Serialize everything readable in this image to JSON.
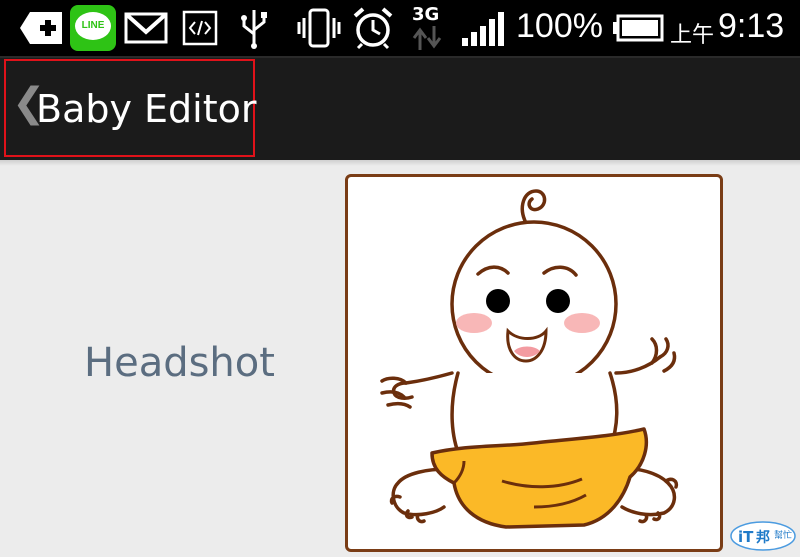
{
  "status_bar": {
    "icons": [
      "add-icon",
      "line-app-icon",
      "gmail-icon",
      "developer-icon",
      "usb-icon",
      "vibrate-icon",
      "alarm-icon",
      "network-3g-icon",
      "signal-icon",
      "battery-icon"
    ],
    "line_label": "LINE",
    "network_label": "3G",
    "battery_percent": "100%",
    "time_prefix": "上午",
    "time": "9:13"
  },
  "action_bar": {
    "title": "Baby Editor",
    "back_glyph": "❮",
    "highlight_color": "#e0121a"
  },
  "form": {
    "headshot_label": "Headshot",
    "headshot_image": "baby-cartoon"
  },
  "watermark": {
    "text": "iT邦 幫忙"
  },
  "colors": {
    "background": "#ececec",
    "action_bar": "#1b1b1b",
    "label": "#5b6d80",
    "image_border": "#7a3d16",
    "diaper": "#fbb927"
  }
}
